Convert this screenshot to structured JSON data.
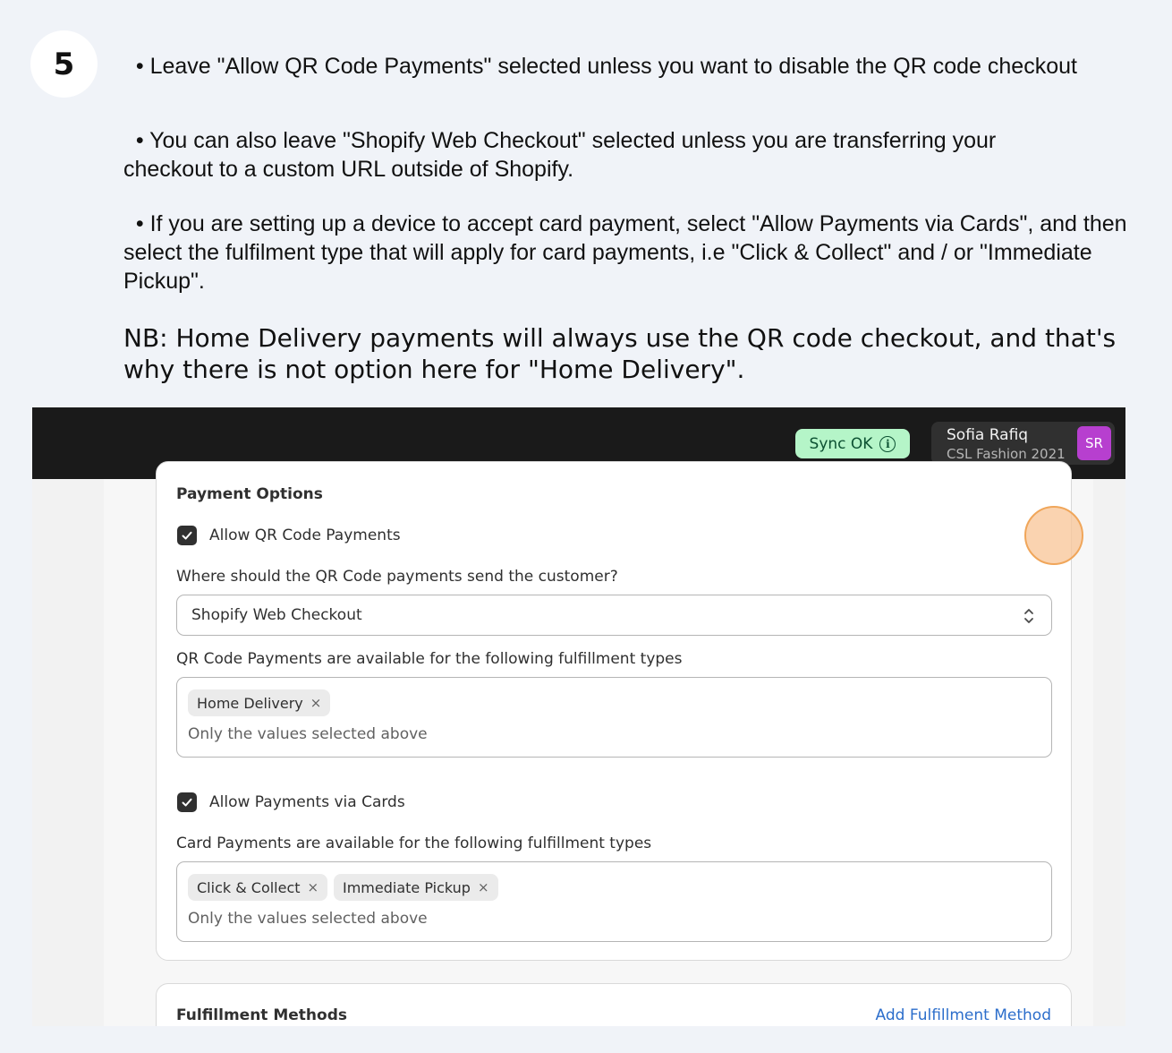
{
  "step": {
    "number": "5"
  },
  "instructions": [
    {
      "text": "Leave \"Allow QR Code Payments\" selected unless you want to disable the QR code checkout"
    },
    {
      "text": "You can also leave \"Shopify Web Checkout\" selected unless you are transferring your checkout to a custom URL outside of Shopify."
    },
    {
      "text": "If you are setting up a device to accept card payment, select \"Allow Payments via Cards\", and then select the fulfilment type that will apply for card payments, i.e \"Click & Collect\" and / or \"Immediate Pickup\"."
    }
  ],
  "note": "NB: Home Delivery payments will always use the QR code checkout, and that's why there is not option here for \"Home Delivery\".",
  "topbar": {
    "sync_label": "Sync OK",
    "sync_icon": "info-icon",
    "user_name": "Sofia Rafiq",
    "store_name": "CSL Fashion 2021",
    "avatar_initials": "SR",
    "avatar_color": "#b73fcf"
  },
  "payment_options": {
    "title": "Payment Options",
    "qr": {
      "checkbox_label": "Allow QR Code Payments",
      "checked": true,
      "destination_label": "Where should the QR Code payments send the customer?",
      "destination_value": "Shopify Web Checkout",
      "fulfillment_label": "QR Code Payments are available for the following fulfillment types",
      "tags": [
        "Home Delivery"
      ],
      "helper": "Only the values selected above"
    },
    "cards": {
      "checkbox_label": "Allow Payments via Cards",
      "checked": true,
      "fulfillment_label": "Card Payments are available for the following fulfillment types",
      "tags": [
        "Click & Collect",
        "Immediate Pickup"
      ],
      "helper": "Only the values selected above"
    }
  },
  "fulfillment_methods": {
    "title": "Fulfillment Methods",
    "add_link": "Add Fulfillment Method"
  },
  "tag_remove_glyph": "×"
}
